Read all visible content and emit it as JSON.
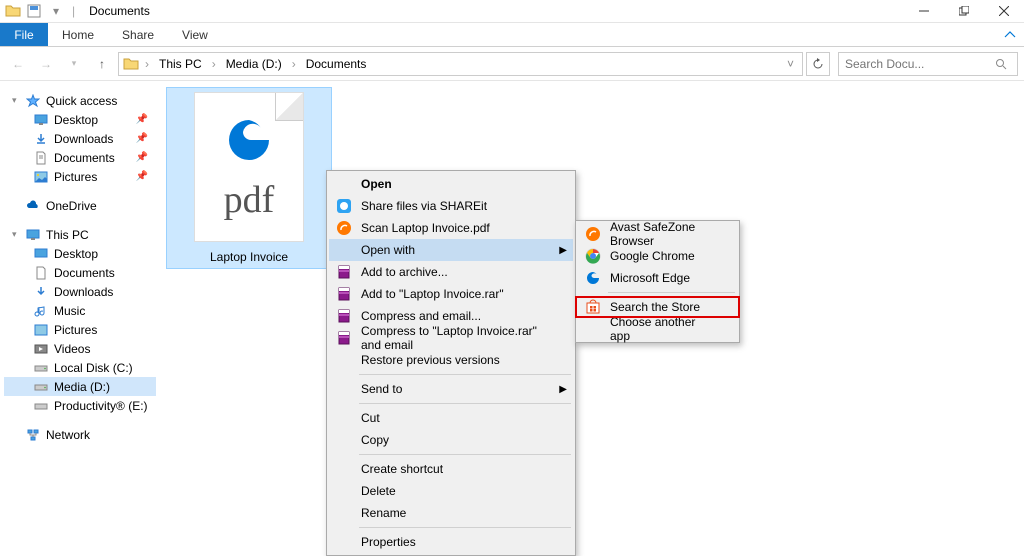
{
  "titlebar": {
    "title": "Documents",
    "minimize": "–",
    "maximize": "❐",
    "close": "✕"
  },
  "ribbon": {
    "file": "File",
    "tabs": [
      "Home",
      "Share",
      "View"
    ]
  },
  "navbar": {
    "crumbs": [
      "This PC",
      "Media (D:)",
      "Documents"
    ],
    "search_placeholder": "Search Docu..."
  },
  "sidebar": {
    "quick_access": {
      "label": "Quick access",
      "items": [
        {
          "label": "Desktop",
          "pinned": true
        },
        {
          "label": "Downloads",
          "pinned": true
        },
        {
          "label": "Documents",
          "pinned": true
        },
        {
          "label": "Pictures",
          "pinned": true
        }
      ]
    },
    "onedrive": {
      "label": "OneDrive"
    },
    "thispc": {
      "label": "This PC",
      "items": [
        {
          "label": "Desktop"
        },
        {
          "label": "Documents"
        },
        {
          "label": "Downloads"
        },
        {
          "label": "Music"
        },
        {
          "label": "Pictures"
        },
        {
          "label": "Videos"
        },
        {
          "label": "Local Disk (C:)"
        },
        {
          "label": "Media (D:)",
          "selected": true
        },
        {
          "label": "Productivity® (E:)"
        }
      ]
    },
    "network": {
      "label": "Network"
    }
  },
  "content": {
    "file": {
      "label": "Laptop Invoice",
      "ext": "pdf"
    }
  },
  "context_menu": {
    "items": [
      {
        "label": "Open",
        "icon": null,
        "bold": true
      },
      {
        "label": "Share files via SHAREit",
        "icon": "shareit"
      },
      {
        "label": "Scan Laptop Invoice.pdf",
        "icon": "avast"
      },
      {
        "label": "Open with",
        "icon": null,
        "highlighted": true,
        "submenu": true
      },
      {
        "label": "Add to archive...",
        "icon": "winrar"
      },
      {
        "label": "Add to \"Laptop Invoice.rar\"",
        "icon": "winrar"
      },
      {
        "label": "Compress and email...",
        "icon": "winrar"
      },
      {
        "label": "Compress to \"Laptop Invoice.rar\" and email",
        "icon": "winrar"
      },
      {
        "label": "Restore previous versions",
        "icon": null
      },
      {
        "divider": true
      },
      {
        "label": "Send to",
        "icon": null,
        "submenu": true
      },
      {
        "divider": true
      },
      {
        "label": "Cut",
        "icon": null
      },
      {
        "label": "Copy",
        "icon": null
      },
      {
        "divider": true
      },
      {
        "label": "Create shortcut",
        "icon": null
      },
      {
        "label": "Delete",
        "icon": null
      },
      {
        "label": "Rename",
        "icon": null
      },
      {
        "divider": true
      },
      {
        "label": "Properties",
        "icon": null
      }
    ]
  },
  "submenu": {
    "items": [
      {
        "label": "Avast SafeZone Browser",
        "icon": "avast"
      },
      {
        "label": "Google Chrome",
        "icon": "chrome"
      },
      {
        "label": "Microsoft Edge",
        "icon": "edge"
      },
      {
        "divider": true
      },
      {
        "label": "Search the Store",
        "icon": "store"
      },
      {
        "label": "Choose another app",
        "icon": null,
        "boxed": true
      }
    ]
  }
}
